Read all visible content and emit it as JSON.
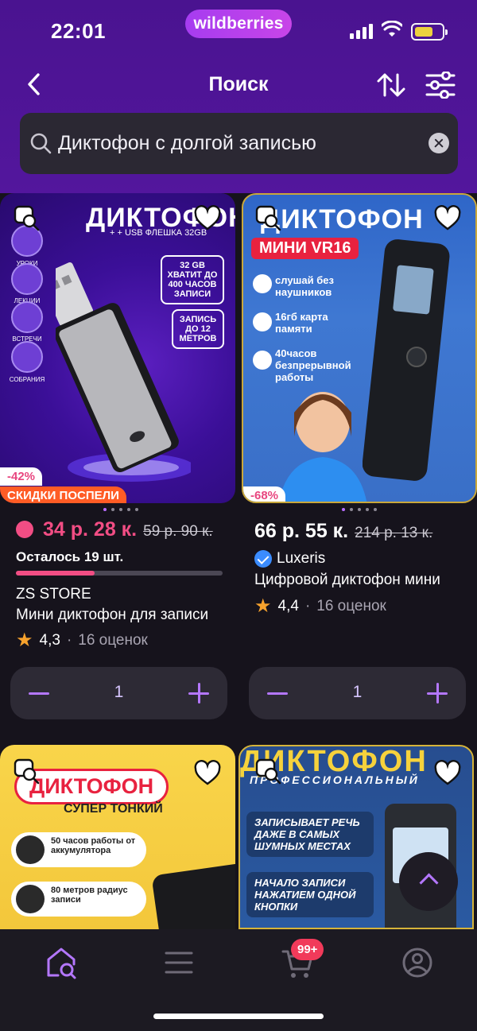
{
  "status_bar": {
    "time": "22:01",
    "brand": "wildberries"
  },
  "nav": {
    "title": "Поиск"
  },
  "search": {
    "query": "Диктофон с долгой записью"
  },
  "products": [
    {
      "image_title": "ДИКТОФОН",
      "image_subtitle": "+ + USB ФЛЕШКА 32GB",
      "image_chip1": "32 GB ХВАТИТ ДО 400 ЧАСОВ ЗАПИСИ",
      "image_chip2": "ЗАПИСЬ ДО 12 МЕТРОВ",
      "image_side": [
        "УРОКИ",
        "ЛЕКЦИИ",
        "ВСТРЕЧИ",
        "СОБРАНИЯ"
      ],
      "discount": "-42%",
      "promo": "СКИДКИ ПОСПЕЛИ",
      "price": "34 р. 28 к.",
      "old_price": "59 р. 90 к.",
      "stock": "Осталось 19 шт.",
      "stock_level": 0.38,
      "brand": "ZS STORE",
      "name": "Мини диктофон для записи",
      "rating": "4,3",
      "reviews": "16 оценок",
      "qty": "1"
    },
    {
      "image_title": "ДИКТОФОН",
      "image_subtitle": "МИНИ VR16",
      "image_features": [
        "слушай без наушников",
        "16гб карта памяти",
        "40часов безпрерывной работы"
      ],
      "discount": "-68%",
      "price": "66 р. 55 к.",
      "old_price": "214 р. 13 к.",
      "brand": "Luxeris",
      "name": "Цифровой диктофон мини",
      "rating": "4,4",
      "reviews": "16 оценок",
      "qty": "1"
    },
    {
      "image_title": "ДИКТОФОН",
      "image_subtitle": "СУПЕР ТОНКИЙ",
      "image_features": [
        "50 часов работы от аккумулятора",
        "80 метров радиус записи"
      ]
    },
    {
      "image_title": "ДИКТОФОН",
      "image_subtitle": "ПРОФЕССИОНАЛЬНЫЙ",
      "image_features": [
        "ЗАПИСЫВАЕТ РЕЧЬ ДАЖЕ В САМЫХ ШУМНЫХ МЕСТАХ",
        "НАЧАЛО ЗАПИСИ НАЖАТИЕМ ОДНОЙ КНОПКИ"
      ]
    }
  ],
  "tabbar": {
    "cart_badge": "99+"
  },
  "colors": {
    "header": "#4a1390",
    "accent": "#b477ff",
    "discount": "#f24d84",
    "promo": "#ff5c25"
  }
}
